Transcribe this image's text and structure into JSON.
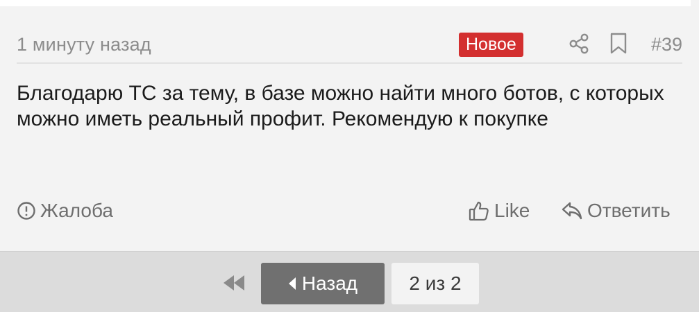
{
  "post": {
    "time": "1 минуту назад",
    "badge": "Новое",
    "number": "#39",
    "text": "Благодарю ТС за тему, в базе можно найти много ботов, с которых можно иметь реальный профит. Рекомендую к покупке",
    "actions": {
      "report": "Жалоба",
      "like": "Like",
      "reply": "Ответить"
    },
    "icons": {
      "share": "share-icon",
      "bookmark": "bookmark-icon",
      "report": "alert-circle-icon",
      "like": "thumbs-up-icon",
      "reply": "reply-icon"
    }
  },
  "pagination": {
    "prev_label": "Назад",
    "status": "2 из 2",
    "icons": {
      "first": "double-chevron-left-icon",
      "prev": "caret-left-icon"
    }
  },
  "colors": {
    "badge": "#d32f2f",
    "prev_button": "#707070",
    "meta_text": "#8c8c8c",
    "body_text": "#1b1b1b"
  }
}
